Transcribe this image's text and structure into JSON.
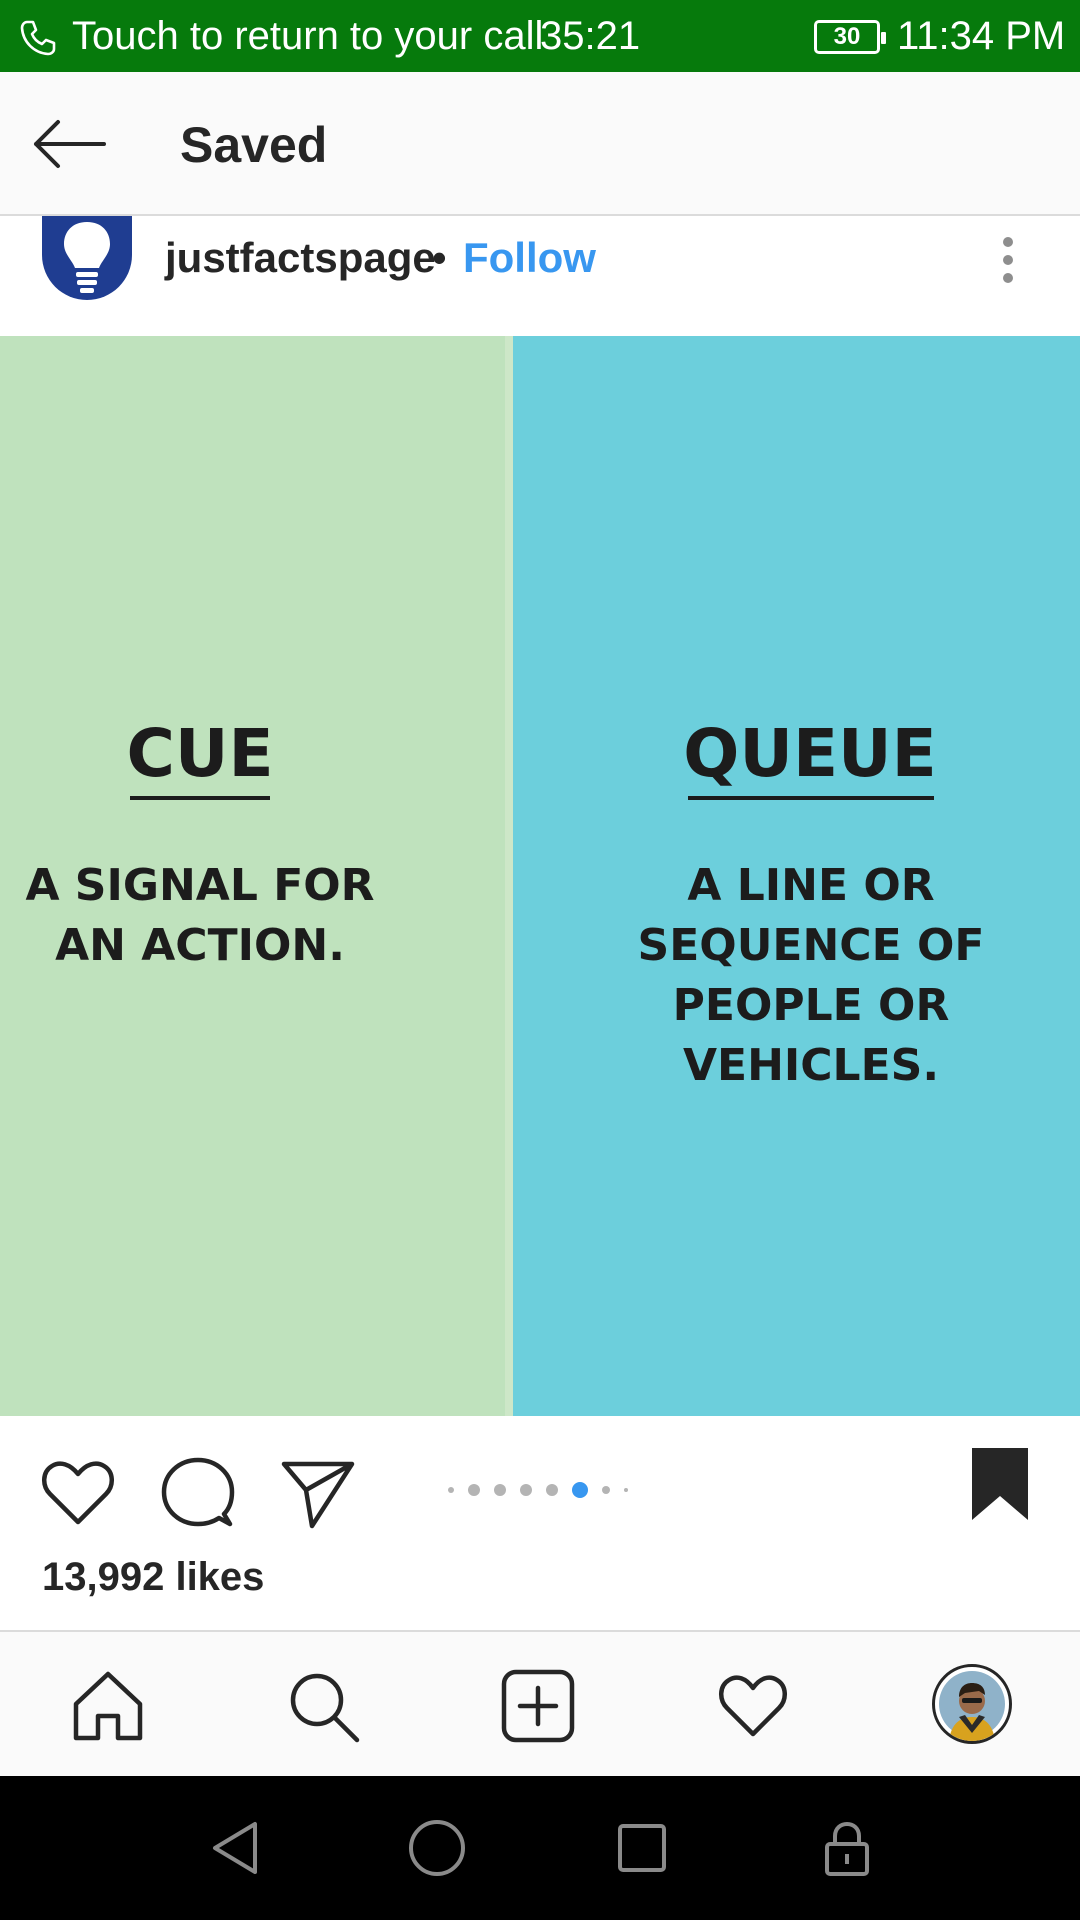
{
  "status_bar": {
    "call_text": "Touch to return to your call",
    "call_timer": "35:21",
    "battery": "30",
    "time": "11:34 PM",
    "bg_color": "#067a0c"
  },
  "app_bar": {
    "title": "Saved",
    "back_icon": "arrow-left-icon"
  },
  "post": {
    "username": "justfactspage",
    "separator": "•",
    "follow_label": "Follow",
    "follow_color": "#3897f0",
    "image": {
      "left_word": "CUE",
      "left_definition": "A SIGNAL FOR AN ACTION.",
      "left_bg": "#bfe2bd",
      "right_word": "QUEUE",
      "right_definition": "A LINE OR SEQUENCE OF PEOPLE OR VEHICLES.",
      "right_bg": "#6ccfdc"
    },
    "carousel": {
      "count": 8,
      "active_index": 5
    },
    "likes": "13,992 likes"
  },
  "bottom_nav": {
    "items": [
      "home-icon",
      "search-icon",
      "new-post-icon",
      "activity-heart-icon",
      "profile-avatar"
    ]
  },
  "system_nav": {
    "items": [
      "back-triangle-icon",
      "home-circle-icon",
      "recents-square-icon",
      "lock-icon"
    ]
  }
}
